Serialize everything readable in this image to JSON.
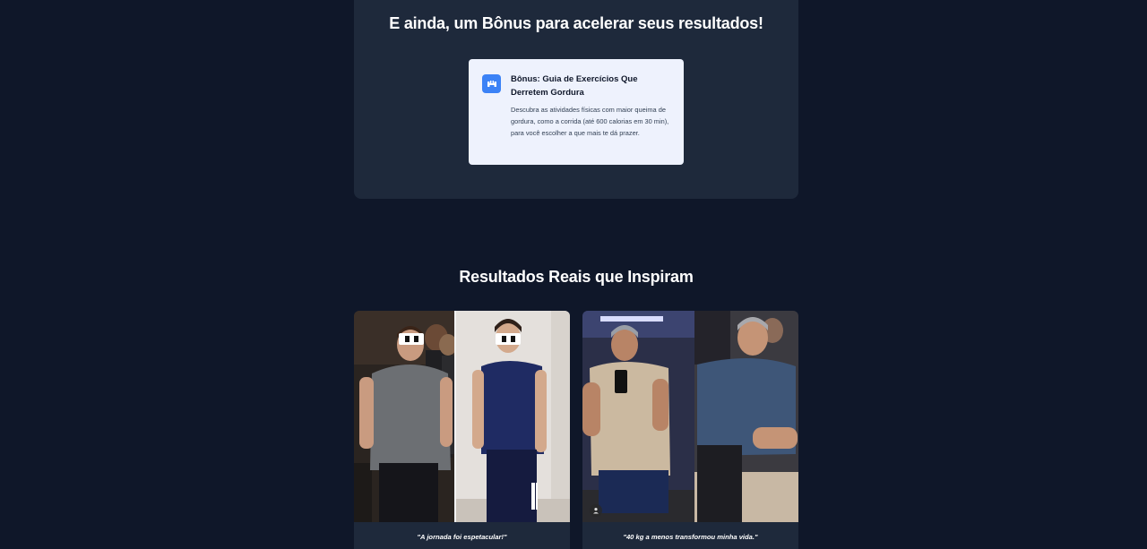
{
  "bonus": {
    "heading": "E ainda, um Bônus para acelerar seus resultados!",
    "card": {
      "icon": "dumbbell-icon",
      "title": "Bônus: Guia de Exercícios Que Derretem Gordura",
      "description": "Descubra as atividades físicas com maior queima de gordura, como a corrida (até 600 calorias em 30 min), para você escolher a que mais te dá prazer."
    }
  },
  "results": {
    "heading": "Resultados Reais que Inspiram",
    "testimonials": [
      {
        "caption": "\"A jornada foi espetacular!\""
      },
      {
        "caption": "\"40 kg a menos transformou minha vida.\""
      }
    ]
  },
  "colors": {
    "background": "#0f1729",
    "section": "#1e293b",
    "card": "#eef2fd",
    "accent": "#3b82f6"
  }
}
